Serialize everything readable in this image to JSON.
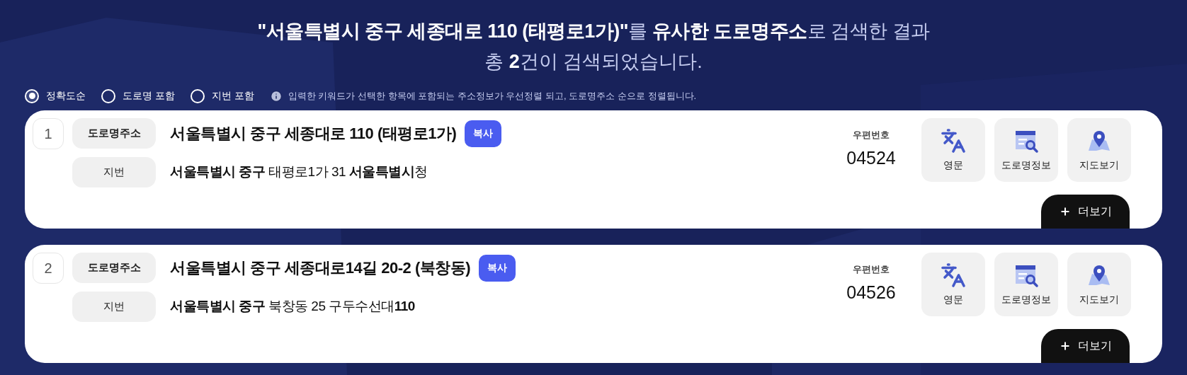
{
  "heading": {
    "line_1": "**\"서울특별시 중구 세종대로 110 (태평로1가)\"**를 **유사한 도로명주소**로 검색한 결과",
    "line_2": "총 **2**건이 검색되었습니다."
  },
  "sort_options": [
    {
      "label": "정확도순",
      "selected": true
    },
    {
      "label": "도로명 포함",
      "selected": false
    },
    {
      "label": "지번 포함",
      "selected": false
    }
  ],
  "sort_note": "입력한 키워드가 선택한 항목에 포함되는 주소정보가 우선정렬 되고, 도로명주소 순으로 정렬됩니다.",
  "results": [
    {
      "number": "1",
      "road_label": "도로명주소",
      "road_address": "서울특별시 중구 세종대로 110 (태평로1가)",
      "copy_button": "복사",
      "lot_label": "지번",
      "lot_address": "**서울특별시 중구** 태평로1가 31 **서울특별시**청",
      "postal_label": "우편번호",
      "postal_code": "04524",
      "actions": [
        {
          "kind": "english",
          "label": "영문"
        },
        {
          "kind": "road_info",
          "label": "도로명정보"
        },
        {
          "kind": "map",
          "label": "지도보기"
        }
      ],
      "more_button": "더보기"
    },
    {
      "number": "2",
      "road_label": "도로명주소",
      "road_address": "서울특별시 중구 세종대로14길 20-2 (북창동)",
      "copy_button": "복사",
      "lot_label": "지번",
      "lot_address": "**서울특별시 중구** 북창동 25 구두수선대**110**",
      "postal_label": "우편번호",
      "postal_code": "04526",
      "actions": [
        {
          "kind": "english",
          "label": "영문"
        },
        {
          "kind": "road_info",
          "label": "도로명정보"
        },
        {
          "kind": "map",
          "label": "지도보기"
        }
      ],
      "more_button": "더보기"
    }
  ]
}
